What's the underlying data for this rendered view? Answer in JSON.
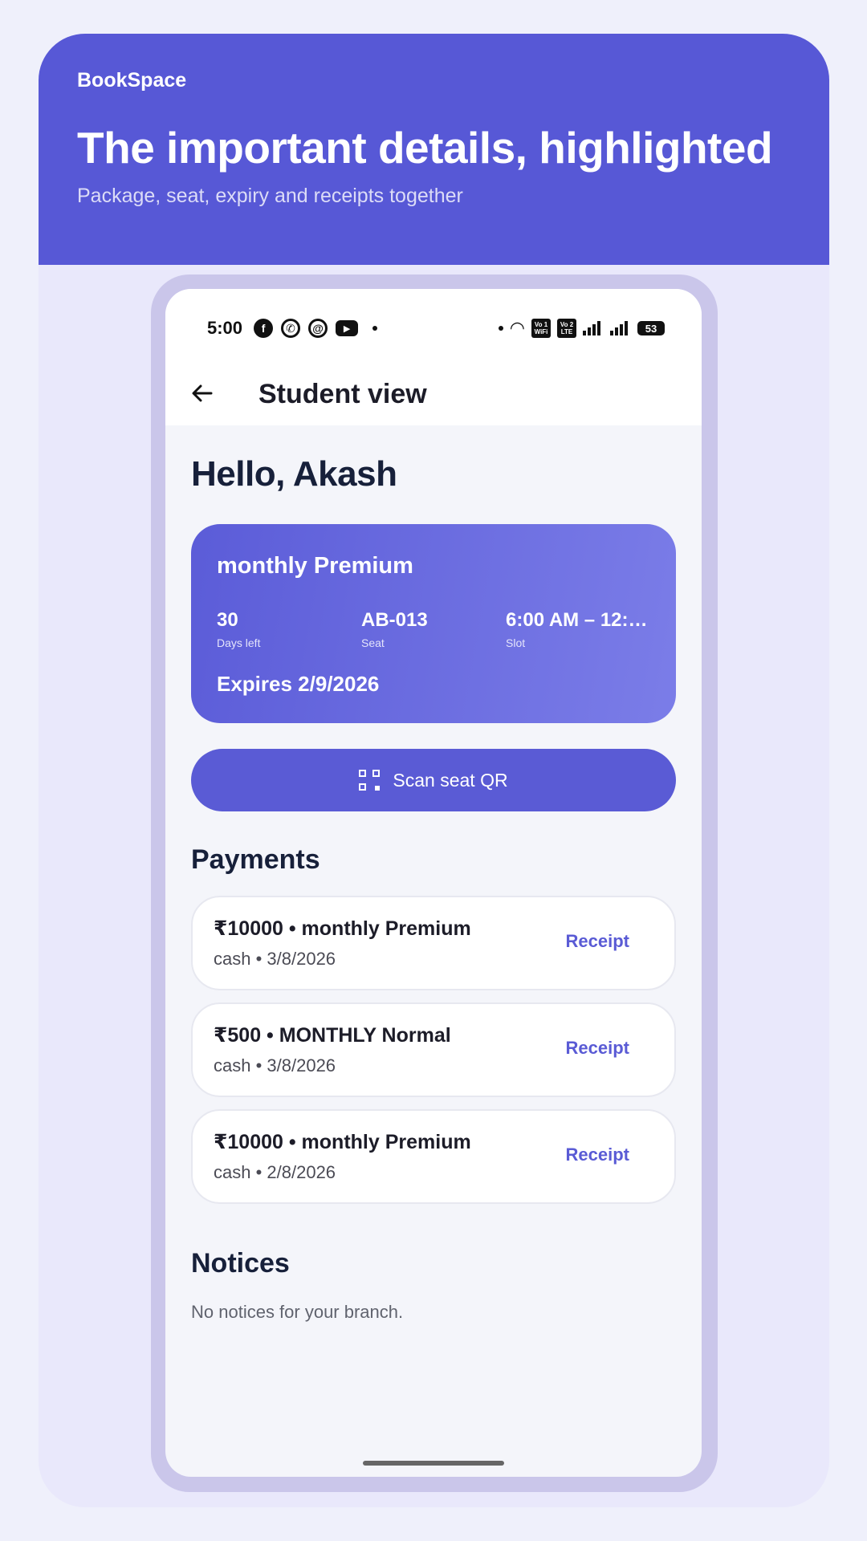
{
  "header": {
    "brand": "BookSpace",
    "headline": "The important details, highlighted",
    "subline": "Package, seat, expiry and receipts together"
  },
  "status_bar": {
    "time": "5:00",
    "icons": [
      "facebook-icon",
      "whatsapp-icon",
      "threads-icon",
      "youtube-icon",
      "wifi-icon",
      "volte-wifi-icon",
      "volte-lte-icon",
      "signal-icon",
      "signal-icon",
      "battery-icon"
    ],
    "chip1": "Vo 1 WiFi",
    "chip2": "Vo 2 LTE",
    "battery": "53"
  },
  "app_bar": {
    "back_icon": "arrow-left-icon",
    "title": "Student view"
  },
  "greeting": "Hello, Akash",
  "package_card": {
    "name": "monthly Premium",
    "days_left": "30",
    "days_left_label": "Days left",
    "seat": "AB-013",
    "seat_label": "Seat",
    "slot": "6:00 AM – 12:…",
    "slot_label": "Slot",
    "expires": "Expires 2/9/2026"
  },
  "scan_button": {
    "label": "Scan seat QR",
    "icon": "qr-scan-icon"
  },
  "payments": {
    "title": "Payments",
    "items": [
      {
        "title": "₹10000 • monthly Premium",
        "sub": "cash • 3/8/2026",
        "action": "Receipt"
      },
      {
        "title": "₹500 • MONTHLY Normal",
        "sub": "cash • 3/8/2026",
        "action": "Receipt"
      },
      {
        "title": "₹10000 • monthly Premium",
        "sub": "cash • 2/8/2026",
        "action": "Receipt"
      }
    ]
  },
  "notices": {
    "title": "Notices",
    "empty": "No notices for your branch."
  },
  "colors": {
    "accent": "#5a5bd5",
    "hero": "#5758d6",
    "page_bg": "#eff0fb",
    "text_dark": "#17203a"
  }
}
